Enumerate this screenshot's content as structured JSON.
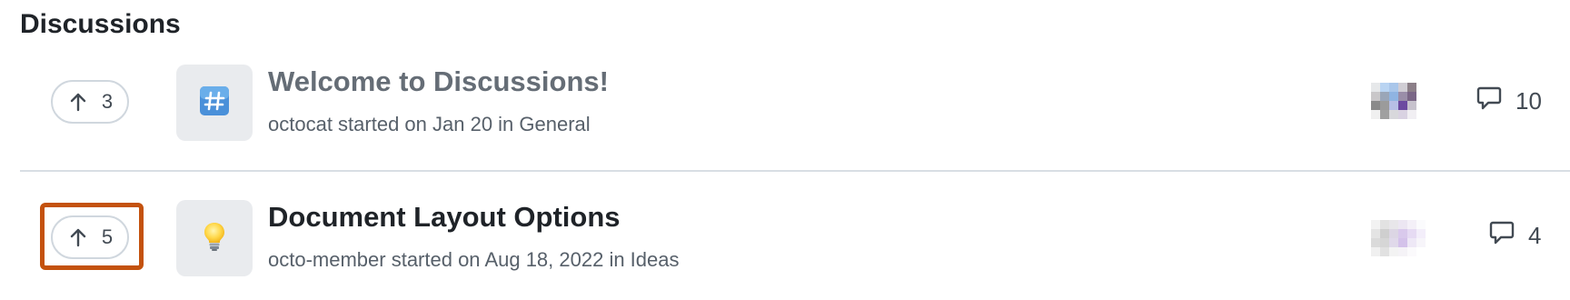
{
  "section": {
    "heading": "Discussions"
  },
  "discussions": [
    {
      "votes": "3",
      "category_icon": "hash-icon",
      "title": "Welcome to Discussions!",
      "meta": "octocat started on Jan 20 in General",
      "comments": "10"
    },
    {
      "votes": "5",
      "category_icon": "lightbulb-icon",
      "title": "Document Layout Options",
      "meta": "octo-member started on Aug 18, 2022 in Ideas",
      "comments": "4",
      "highlighted": true
    }
  ],
  "colors": {
    "highlight": "#c4520e",
    "category_bg": "#e9ebee",
    "divider": "#d8dee4"
  }
}
